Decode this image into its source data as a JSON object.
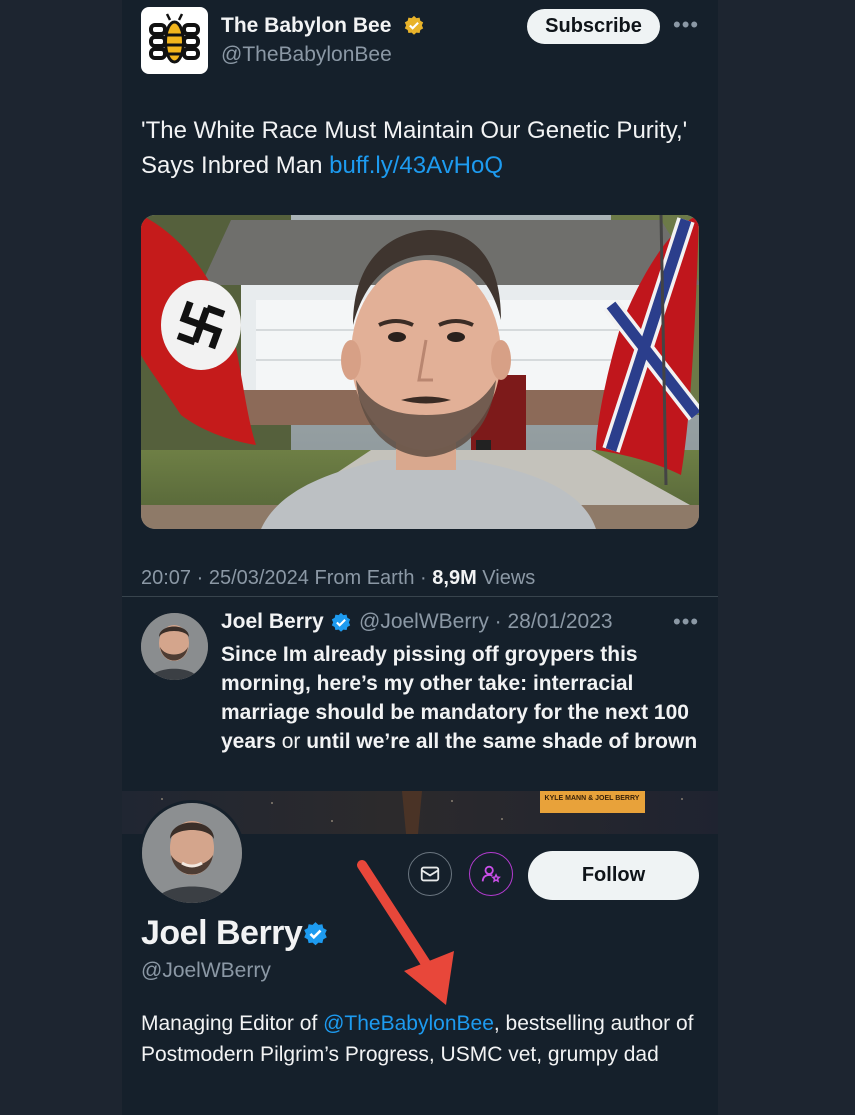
{
  "tweet": {
    "account_name": "The Babylon Bee",
    "account_handle": "@TheBabylonBee",
    "subscribe_label": "Subscribe",
    "more_icon": "ellipsis-icon",
    "text": "'The White Race Must Maintain Our Genetic Purity,' Says Inbred Man ",
    "link": "buff.ly/43AvHoQ",
    "meta_time": "20:07 · 25/03/2024 From Earth · ",
    "meta_views_count": "8,9M",
    "meta_views_label": " Views"
  },
  "quoted": {
    "name": "Joel Berry",
    "handle": "@JoelWBerry · 28/01/2023",
    "text_bold_1": "Since Im already pissing off groypers this morning, here’s my other take: interracial marriage should be mandatory for the next 100 years",
    "text_plain": " or ",
    "text_bold_2": "until we’re all the same shade of brown"
  },
  "profile": {
    "name": "Joel Berry",
    "handle": "@JoelWBerry",
    "follow_label": "Follow",
    "bio_prefix": "Managing Editor of ",
    "bio_mention": "@TheBabylonBee",
    "bio_suffix": ", bestselling author of Postmodern Pilgrim’s Progress, USMC vet, grumpy dad",
    "banner_book_text": "KYLE MANN & JOEL BERRY"
  },
  "colors": {
    "background": "#15202b",
    "link": "#1d9bf0",
    "verified_gold": "#e8b32a",
    "verified_blue": "#1d9bf0",
    "arrow": "#e8473a"
  }
}
